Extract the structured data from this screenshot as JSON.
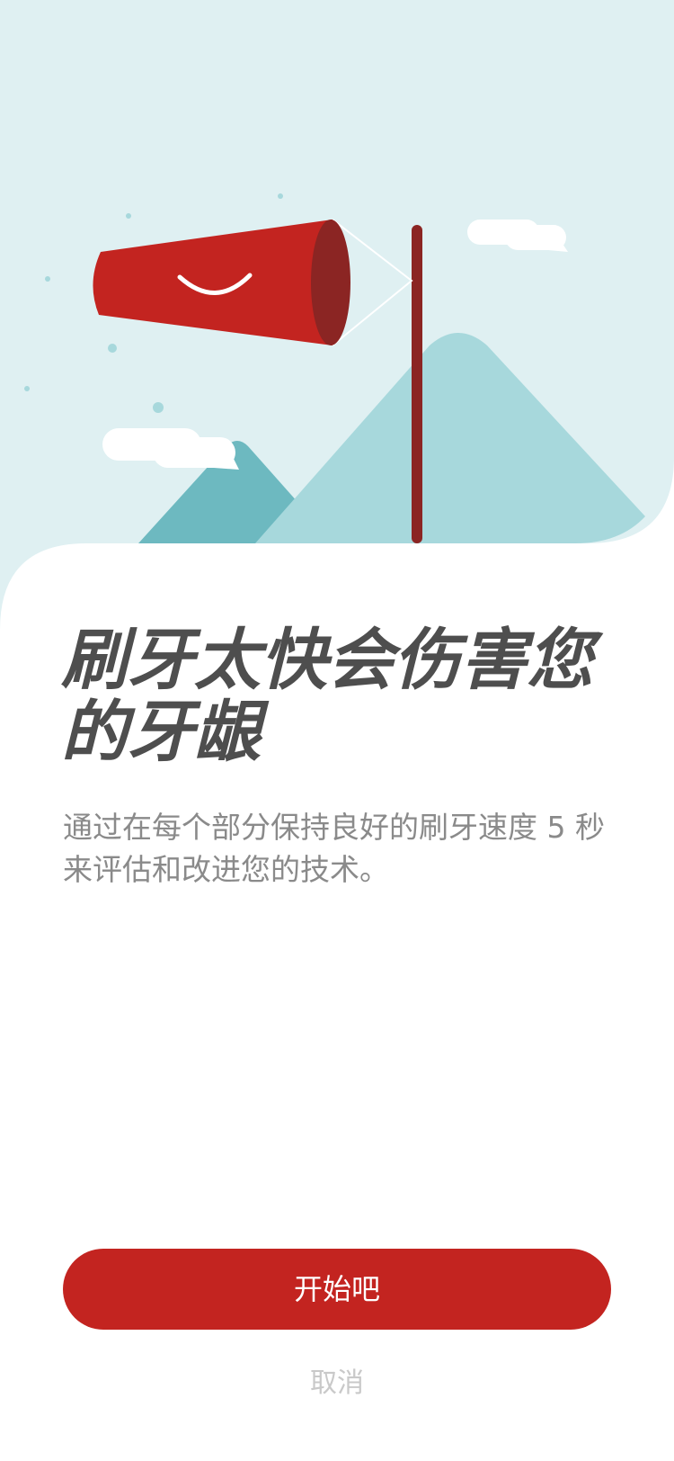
{
  "content": {
    "title": "刷牙太快会伤害您的牙龈",
    "description": "通过在每个部分保持良好的刷牙速度 5 秒来评估和改进您的技术。"
  },
  "actions": {
    "start_label": "开始吧",
    "cancel_label": "取消"
  },
  "illustration": {
    "icon": "windsock-mountains-illustration"
  },
  "colors": {
    "accent": "#c32420",
    "sky": "#dff0f2",
    "mountain": "#a7d8dc",
    "mountain_dark": "#6db9c0",
    "title": "#4e4e4e",
    "description": "#8a8a8a",
    "cancel": "#c9c9c9"
  }
}
